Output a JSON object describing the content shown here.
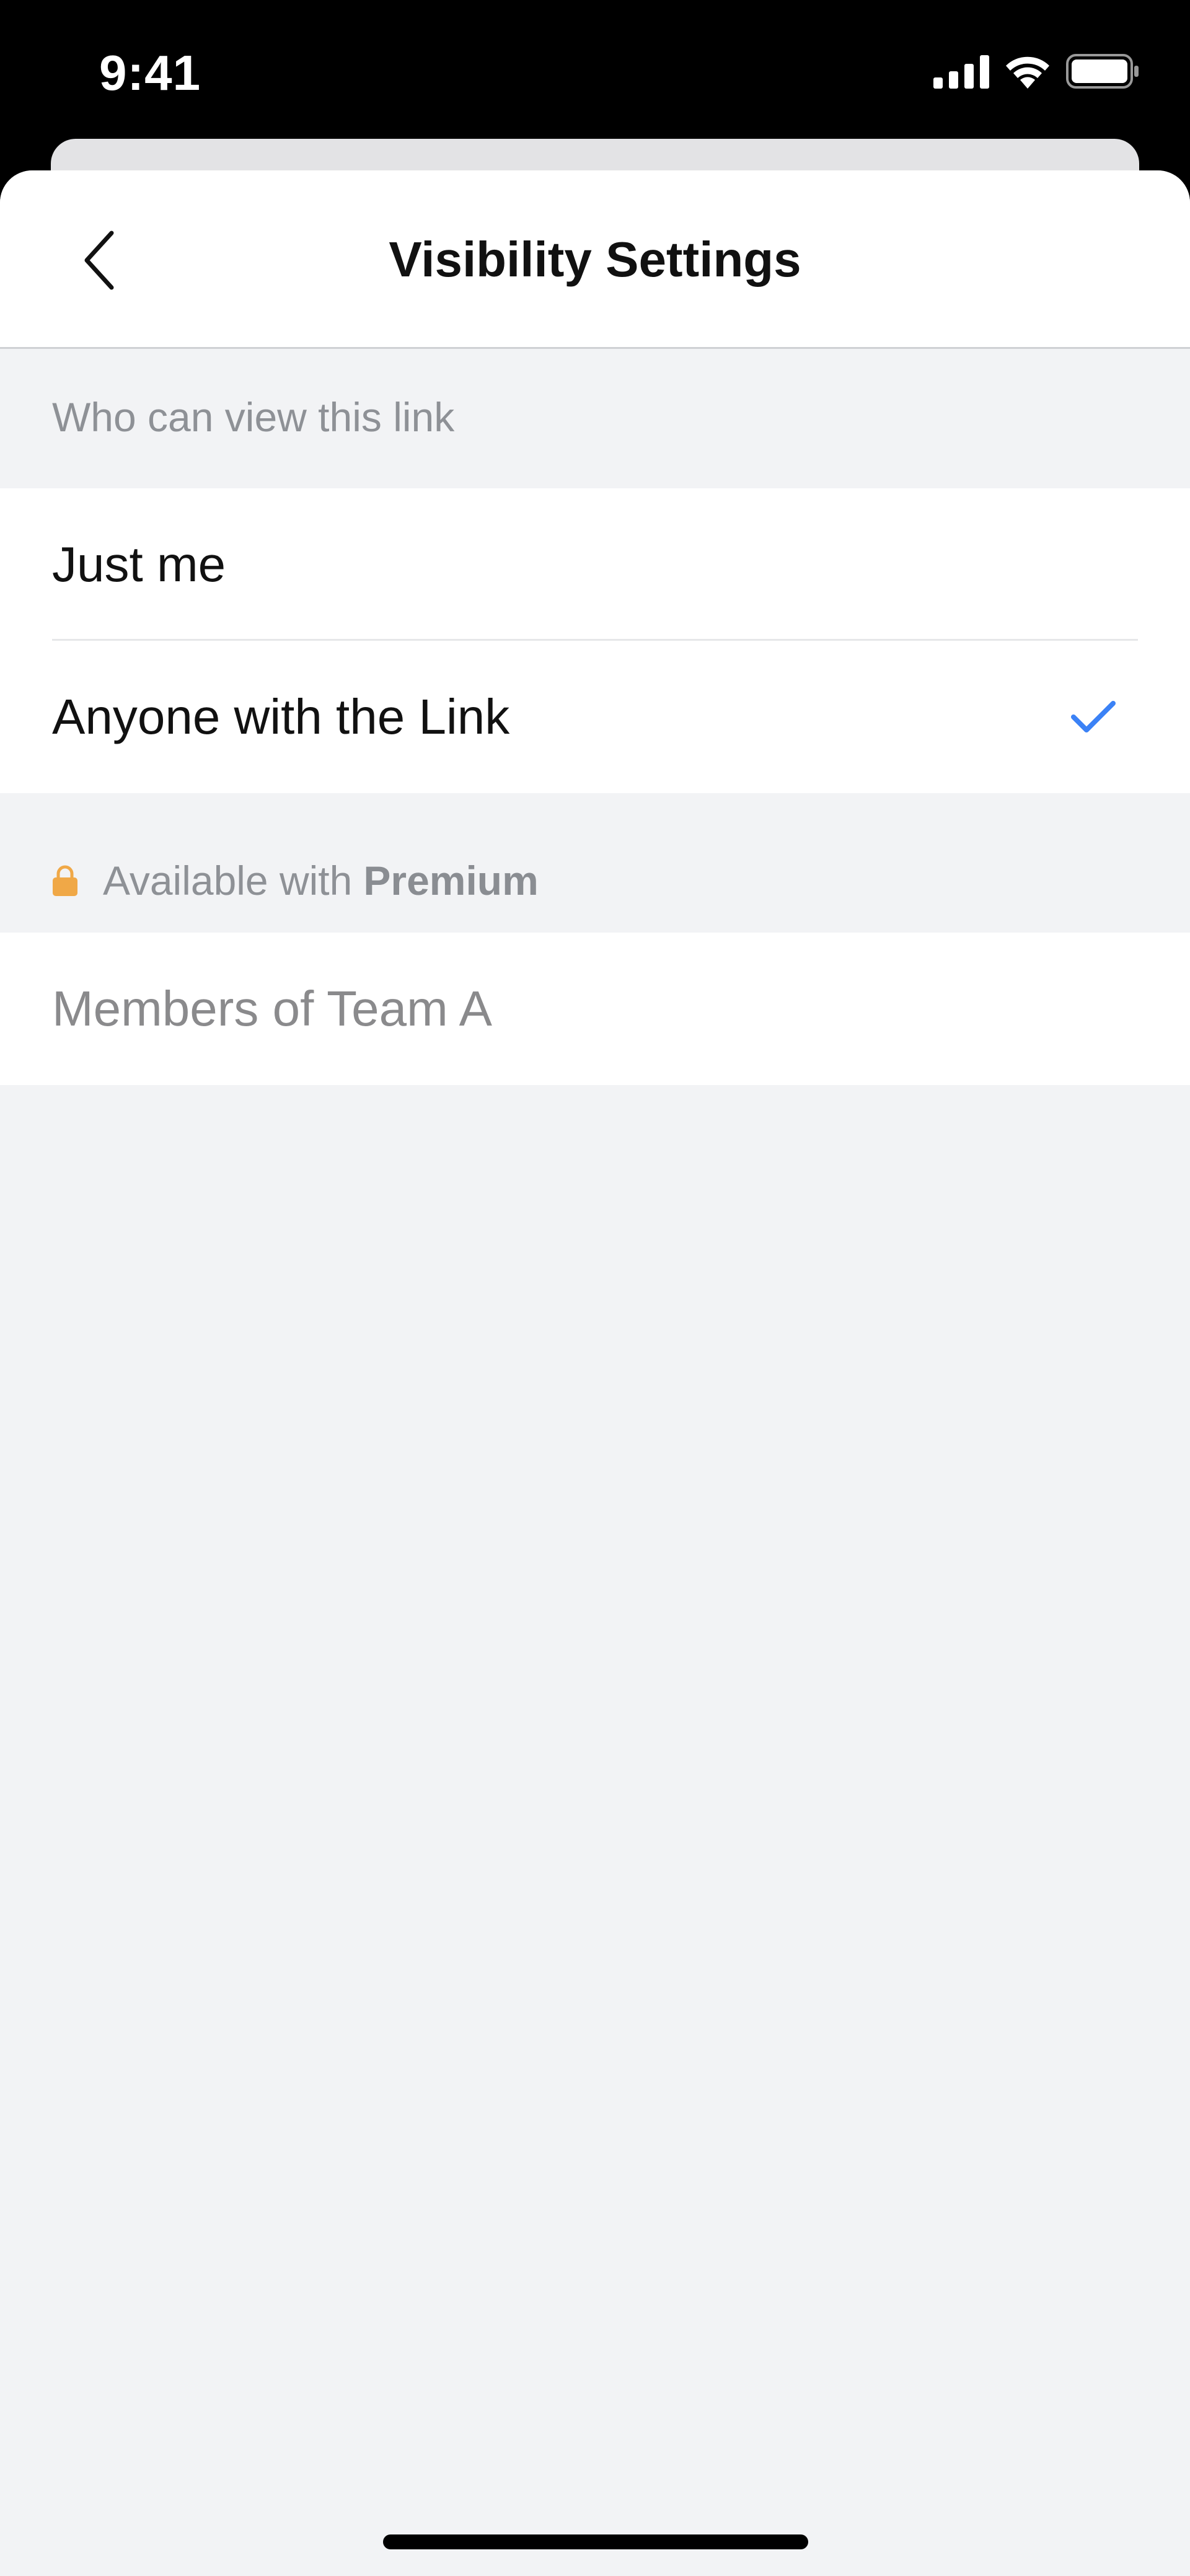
{
  "status_bar": {
    "time": "9:41",
    "icons": [
      "cellular-signal-icon",
      "wifi-icon",
      "battery-icon"
    ]
  },
  "nav": {
    "back_icon": "chevron-left-icon",
    "title": "Visibility Settings"
  },
  "visibility_section": {
    "header": "Who can view this link",
    "options": [
      {
        "label": "Just me",
        "selected": false
      },
      {
        "label": "Anyone with the Link",
        "selected": true
      }
    ]
  },
  "premium_section": {
    "icon": "lock-icon",
    "header_prefix": "Available with",
    "header_emphasis": "Premium",
    "options": [
      {
        "label": "Members of Team A",
        "enabled": false
      }
    ]
  },
  "colors": {
    "accent": "#3b82f6",
    "lock": "#f0a847",
    "background": "#f2f3f5",
    "disabled_text": "#8a8a8c"
  }
}
